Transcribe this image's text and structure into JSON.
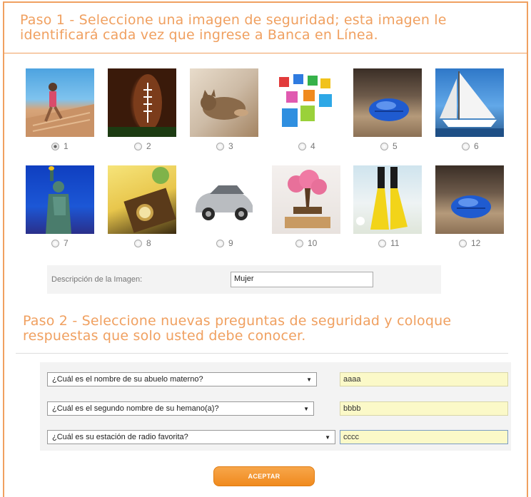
{
  "step1": {
    "title": "Paso 1 - Seleccione una imagen de seguridad; esta imagen le identificará cada vez que ingrese a Banca en Línea."
  },
  "images": [
    {
      "label": "1",
      "icon": "runner-stairs-image",
      "selected": true
    },
    {
      "label": "2",
      "icon": "football-image",
      "selected": false
    },
    {
      "label": "3",
      "icon": "cat-image",
      "selected": false
    },
    {
      "label": "4",
      "icon": "colored-cubes-image",
      "selected": false
    },
    {
      "label": "5",
      "icon": "blue-shell-image",
      "selected": false
    },
    {
      "label": "6",
      "icon": "sailboat-image",
      "selected": false
    },
    {
      "label": "7",
      "icon": "statue-of-liberty-image",
      "selected": false
    },
    {
      "label": "8",
      "icon": "pocket-watch-image",
      "selected": false
    },
    {
      "label": "9",
      "icon": "car-image",
      "selected": false
    },
    {
      "label": "10",
      "icon": "bonsai-tree-image",
      "selected": false
    },
    {
      "label": "11",
      "icon": "flippers-image",
      "selected": false
    },
    {
      "label": "12",
      "icon": "blue-shell-image",
      "selected": false
    }
  ],
  "description": {
    "label": "Descripción de la Imagen:",
    "value": "Mujer"
  },
  "step2": {
    "title": "Paso 2 - Seleccione nuevas preguntas de seguridad y coloque respuestas que solo usted debe conocer."
  },
  "questions": [
    {
      "question": "¿Cuál es el nombre de su abuelo materno?",
      "answer": "aaaa"
    },
    {
      "question": "¿Cuál es el segundo nombre de su hemano(a)?",
      "answer": "bbbb"
    },
    {
      "question": "¿Cuál es su estación de radio favorita?",
      "answer": "cccc"
    }
  ],
  "submit": {
    "label": "ACEPTAR"
  },
  "colors": {
    "accent": "#f0a060",
    "button": "#f08a1e",
    "answer_bg": "#fbf9c8"
  }
}
